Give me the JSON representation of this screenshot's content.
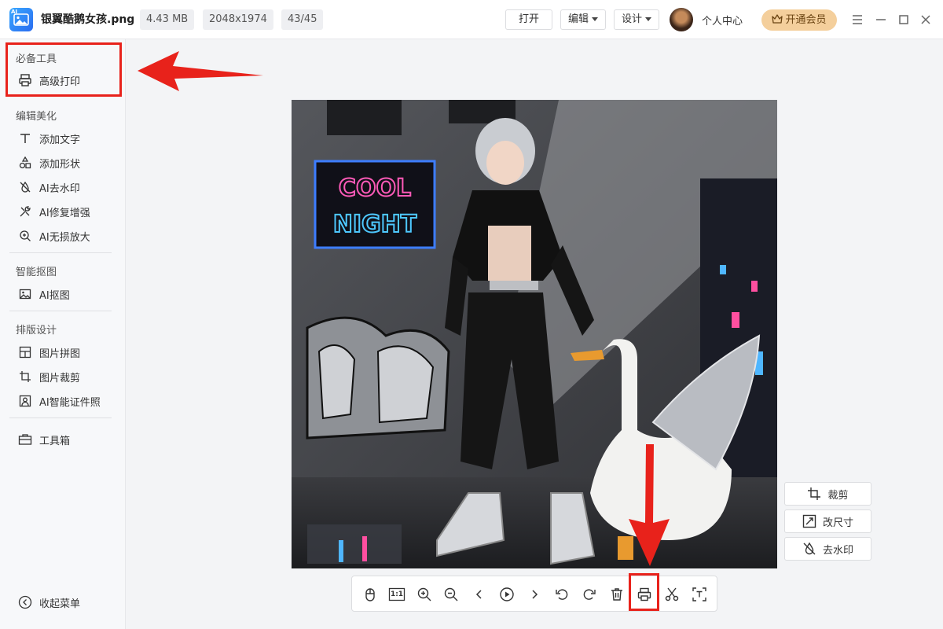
{
  "titlebar": {
    "filename": "银翼酷鹅女孩.png",
    "file_size": "4.43 MB",
    "resolution": "2048x1974",
    "page_index": "43/45",
    "open_label": "打开",
    "edit_label": "编辑",
    "design_label": "设计",
    "user_center_label": "个人中心",
    "vip_label": "开通会员"
  },
  "sidebar": {
    "sections": [
      {
        "title": "必备工具",
        "items": [
          {
            "label": "高级打印",
            "icon": "printer-icon"
          }
        ]
      },
      {
        "title": "编辑美化",
        "items": [
          {
            "label": "添加文字",
            "icon": "text-icon"
          },
          {
            "label": "添加形状",
            "icon": "shapes-icon"
          },
          {
            "label": "AI去水印",
            "icon": "drop-slash-icon"
          },
          {
            "label": "AI修复增强",
            "icon": "tools-icon"
          },
          {
            "label": "AI无损放大",
            "icon": "zoom-plus-icon"
          }
        ]
      },
      {
        "title": "智能抠图",
        "items": [
          {
            "label": "AI抠图",
            "icon": "image-icon"
          }
        ]
      },
      {
        "title": "排版设计",
        "items": [
          {
            "label": "图片拼图",
            "icon": "grid-icon"
          },
          {
            "label": "图片裁剪",
            "icon": "crop-icon"
          },
          {
            "label": "AI智能证件照",
            "icon": "id-photo-icon"
          }
        ]
      }
    ],
    "toolbox_label": "工具箱",
    "collapse_label": "收起菜单"
  },
  "image": {
    "sign_line1": "COOL",
    "sign_line2": "NIGHT"
  },
  "right_tools": [
    {
      "label": "裁剪",
      "icon": "crop-icon"
    },
    {
      "label": "改尺寸",
      "icon": "resize-icon"
    },
    {
      "label": "去水印",
      "icon": "drop-slash-icon"
    }
  ],
  "bottom_toolbar": {
    "actual_size_label": "1:1",
    "buttons": [
      "pan-icon",
      "actual-size-icon",
      "zoom-in-icon",
      "zoom-out-icon",
      "prev-icon",
      "play-icon",
      "next-icon",
      "rotate-left-icon",
      "rotate-right-icon",
      "delete-icon",
      "print-icon",
      "cut-icon",
      "text-recognize-icon"
    ]
  },
  "colors": {
    "accent_red": "#e8221b",
    "vip_gold": "#f4cf9c",
    "brand_blue": "#2a6cf0"
  }
}
